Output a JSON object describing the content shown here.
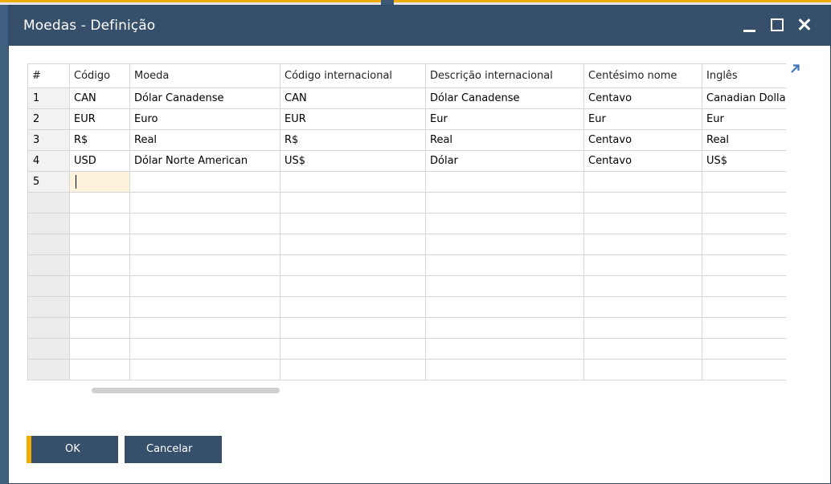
{
  "window": {
    "title": "Moedas - Definição"
  },
  "titlebar_buttons": {
    "minimize": "minimize-icon",
    "maximize": "maximize-icon",
    "close": "close-icon"
  },
  "grid": {
    "columns": [
      "#",
      "Código",
      "Moeda",
      "Código internacional",
      "Descrição internacional",
      "Centésimo nome",
      "Inglês"
    ],
    "rows": [
      [
        "1",
        "CAN",
        "Dólar Canadense",
        "CAN",
        "Dólar Canadense",
        "Centavo",
        "Canadian Dollar"
      ],
      [
        "2",
        "EUR",
        "Euro",
        "EUR",
        "Eur",
        "Eur",
        "Eur"
      ],
      [
        "3",
        "R$",
        "Real",
        "R$",
        "Real",
        "Centavo",
        "Real"
      ],
      [
        "4",
        "USD",
        "Dólar Norte American",
        "US$",
        "Dólar",
        "Centavo",
        "US$"
      ],
      [
        "5",
        "",
        "",
        "",
        "",
        "",
        ""
      ]
    ]
  },
  "expand_icon": "expand-arrow-icon",
  "buttons": {
    "ok": "OK",
    "cancel": "Cancelar"
  },
  "colors": {
    "titlebar": "#36506b",
    "accent": "#f0ab00",
    "active_cell": "#fdf2dc"
  }
}
